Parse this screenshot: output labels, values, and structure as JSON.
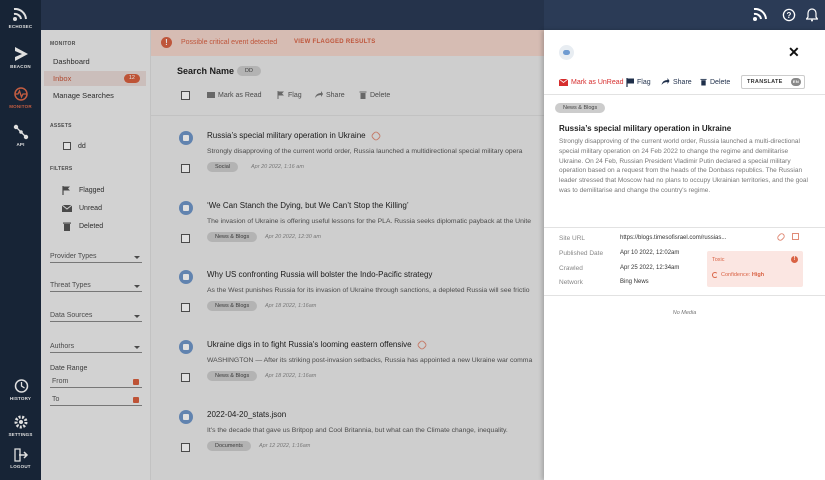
{
  "app": {
    "brand": "ECHOSEC"
  },
  "rail": {
    "items": [
      {
        "label": "BEACON",
        "icon": "beacon-icon"
      },
      {
        "label": "MONITOR",
        "icon": "monitor-icon",
        "active": true
      },
      {
        "label": "API",
        "icon": "api-icon"
      }
    ],
    "bottom": [
      {
        "label": "HISTORY",
        "icon": "history-icon"
      },
      {
        "label": "SETTINGS",
        "icon": "settings-icon"
      },
      {
        "label": "LOGOUT",
        "icon": "logout-icon"
      }
    ]
  },
  "sidebar": {
    "monitor_title": "MONITOR",
    "nav": [
      {
        "label": "Dashboard"
      },
      {
        "label": "Inbox",
        "badge": "12",
        "active": true
      },
      {
        "label": "Manage Searches"
      }
    ],
    "assets_title": "ASSETS",
    "asset": "dd",
    "filters_title": "FILTERS",
    "filters": [
      "Flagged",
      "Unread",
      "Deleted"
    ],
    "dropdowns": [
      "Provider Types",
      "Threat Types",
      "Data Sources",
      "Authors"
    ],
    "date_range_label": "Date Range",
    "from_placeholder": "From",
    "to_placeholder": "To"
  },
  "alert": {
    "text": "Possible critical event detected",
    "action": "VIEW FLAGGED RESULTS"
  },
  "search": {
    "name_label": "Search Name",
    "chip": "DD"
  },
  "toolbar": {
    "mark_read": "Mark as Read",
    "flag": "Flag",
    "share": "Share",
    "delete": "Delete"
  },
  "results": [
    {
      "title": "Russia’s special military operation in Ukraine",
      "snippet": "Strongly disapproving of the current world order, Russia launched a multidirectional special military opera",
      "category": "Social",
      "date": "Apr 20 2022, 1:16 am",
      "source": "twitter-icon",
      "has_link": true
    },
    {
      "title": "‘We Can Stanch the Dying, but We Can’t Stop the Killing’",
      "snippet": "The invasion of Ukraine is offering useful lessons for the PLA. Russia seeks diplomatic payback at the Unite",
      "category": "News & Blogs",
      "date": "Apr 20 2022, 12:30 am",
      "source": "news-icon",
      "has_link": false
    },
    {
      "title": "Why US confronting Russia will bolster the Indo-Pacific strategy",
      "snippet": "As the West punishes Russia for its invasion of Ukraine through sanctions, a depleted Russia will see frictio",
      "category": "News & Blogs",
      "date": "Apr 18 2022, 1:16am",
      "source": "news-icon",
      "has_link": false
    },
    {
      "title": "Ukraine digs in to fight Russia's looming eastern offensive",
      "snippet": "WASHINGTON — After its striking post-invasion setbacks, Russia has appointed a new Ukraine war comma",
      "category": "News & Blogs",
      "date": "Apr 18 2022, 1:16am",
      "source": "twitter-icon",
      "has_link": true
    },
    {
      "title": "2022-04-20_stats.json",
      "snippet": "It's the decade that gave us Britpop and Cool Britannia, but what can the Climate change, inequality.",
      "category": "Documents",
      "date": "Apr 12 2022, 1:16am",
      "source": "document-icon",
      "has_link": false
    }
  ],
  "detail": {
    "actions": {
      "mark_unread": "Mark as UnRead",
      "flag": "Flag",
      "share": "Share",
      "delete": "Delete",
      "translate": "TRANSLATE",
      "lang": "EN"
    },
    "category": "News & Blogs",
    "title": "Russia’s special military operation in Ukraine",
    "body": "Strongly disapproving of the current world order, Russia launched a multi-directional special military operation on 24 Feb 2022 to change the regime and demilitarise Ukraine. On 24 Feb, Russian President Vladimir Putin declared a special military operation based on a request from the heads of the Donbass republics. The Russian leader stressed that Moscow had no plans to occupy Ukrainian territories, and the goal was to demilitarise and change the country's regime.",
    "site_url_label": "Site URL",
    "site_url": "https://blogs.timesofisrael.com/russias...",
    "published_label": "Published Date",
    "published": "Apr 10 2022, 12:02am",
    "crawled_label": "Crawled",
    "crawled": "Apr 25 2022, 12:34am",
    "network_label": "Network",
    "network": "Bing News",
    "toxic_label": "Toxic",
    "confidence_label": "Confidence:",
    "confidence": "High",
    "no_media": "No Media"
  }
}
